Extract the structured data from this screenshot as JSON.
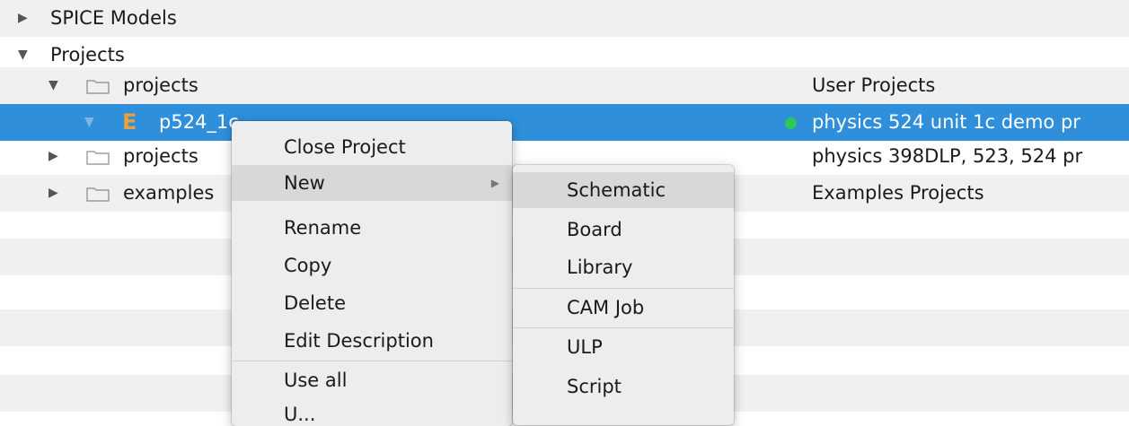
{
  "tree": {
    "rows": [
      {
        "label": "SPICE Models",
        "expander": "▶"
      },
      {
        "label": "Projects",
        "expander": "▼"
      },
      {
        "label": "projects",
        "expander": "▼",
        "description": "User Projects"
      },
      {
        "label": "p524_1c",
        "expander": "▼",
        "icon": "E",
        "description": "physics 524 unit 1c demo pr"
      },
      {
        "label": "projects",
        "expander": "▶",
        "description": "physics 398DLP, 523, 524 pr"
      },
      {
        "label": "examples",
        "expander": "▶",
        "description": "Examples Projects"
      }
    ]
  },
  "context_menu": {
    "items": [
      "Close Project",
      "New",
      "Rename",
      "Copy",
      "Delete",
      "Edit Description",
      "Use all",
      "U..."
    ],
    "submenu_arrow": "▶"
  },
  "submenu": {
    "items": [
      "Schematic",
      "Board",
      "Library",
      "CAM Job",
      "ULP",
      "Script"
    ]
  },
  "colors": {
    "selection": "#2f8fdb",
    "status_dot": "#2ec85a",
    "project_icon": "#e6a040",
    "menu_highlight": "#d8d8d8"
  }
}
